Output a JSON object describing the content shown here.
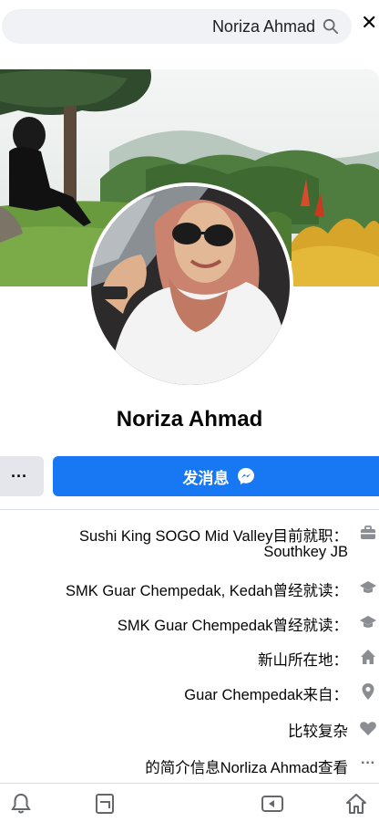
{
  "search": {
    "value": "Noriza Ahmad"
  },
  "profile": {
    "name": "Noriza Ahmad",
    "message_button": "发消息"
  },
  "info": {
    "work_label": "目前就职：",
    "work_value_line1": "Sushi King SOGO Mid Valley",
    "work_value_line2": "Southkey JB",
    "school1_label": "曾经就读：",
    "school1_value": "SMK Guar Chempedak, Kedah",
    "school2_label": "曾经就读：",
    "school2_value": "SMK Guar Chempedak",
    "location_label": "所在地：",
    "location_value": "新山",
    "from_label": "来自：",
    "from_value": "Guar Chempedak",
    "relationship": "比较复杂",
    "see_more_prefix": "查看 ",
    "see_more_name": "Norliza Ahmad",
    "see_more_suffix": "的简介信息"
  },
  "icons": {
    "close": "close-icon",
    "search": "search-icon",
    "messenger": "messenger-icon",
    "work": "briefcase-icon",
    "school": "graduation-cap-icon",
    "home": "home-icon",
    "location": "location-pin-icon",
    "heart": "heart-icon",
    "more": "ellipsis-icon"
  },
  "colors": {
    "accent": "#1877f2",
    "button_grey": "#e4e6eb",
    "search_bg": "#f0f2f5"
  }
}
